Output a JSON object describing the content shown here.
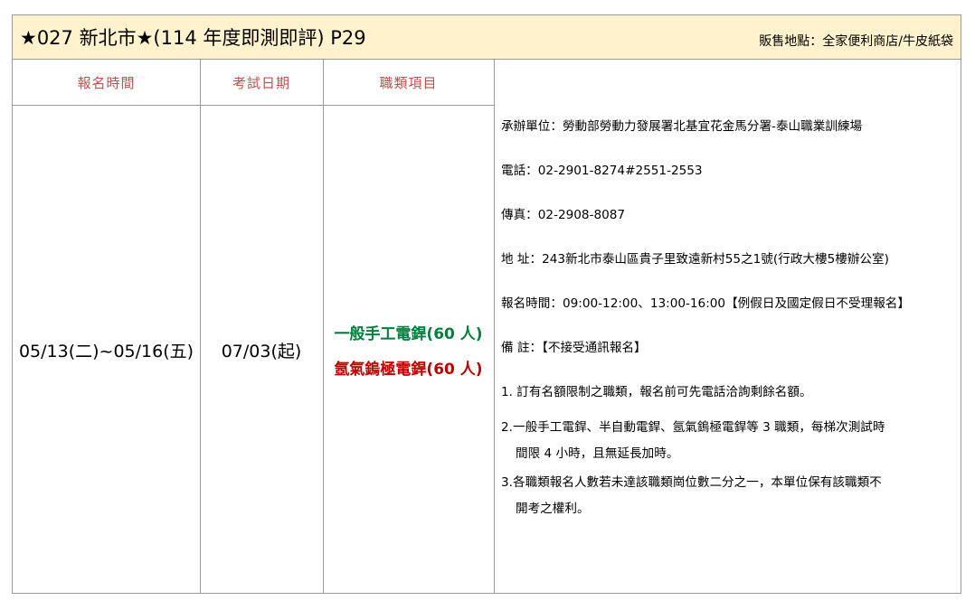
{
  "header": {
    "title": "★027 新北市★(114 年度即測即評) P29",
    "sale_location": "販售地點：全家便利商店/牛皮紙袋"
  },
  "columns": {
    "register_period": "報名時間",
    "exam_date": "考試日期",
    "job_items": "職類項目"
  },
  "row": {
    "register_period": "05/13(二)~05/16(五)",
    "exam_date": "07/03(起)",
    "jobs": [
      "一般手工電銲(60 人)",
      "氬氣鎢極電銲(60 人)"
    ],
    "job_colors": [
      "#00803c",
      "#c00000"
    ]
  },
  "info": {
    "organizer": "承辦單位：勞動部勞動力發展署北基宜花金馬分署-泰山職業訓練場",
    "phone": "電話：02-2901-8274#2551-2553",
    "fax": "傳真：02-2908-8087",
    "address": "地  址：243新北市泰山區貴子里致遠新村55之1號(行政大樓5樓辦公室)",
    "register_time": "報名時間：09:00-12:00、13:00-16:00【例假日及國定假日不受理報名】",
    "remark": "備  註：【不接受通訊報名】",
    "note1": "1. 訂有名額限制之職類，報名前可先電話洽詢剩餘名額。",
    "note2_line1": "2.一般手工電銲、半自動電銲、氬氣鎢極電銲等 3 職類，每梯次測試時",
    "note2_line2": "間限 4 小時，且無延長加時。",
    "note3_line1": "3.各職類報名人數若未達該職類崗位數二分之一，本單位保有該職類不",
    "note3_line2": "開考之權利。"
  }
}
